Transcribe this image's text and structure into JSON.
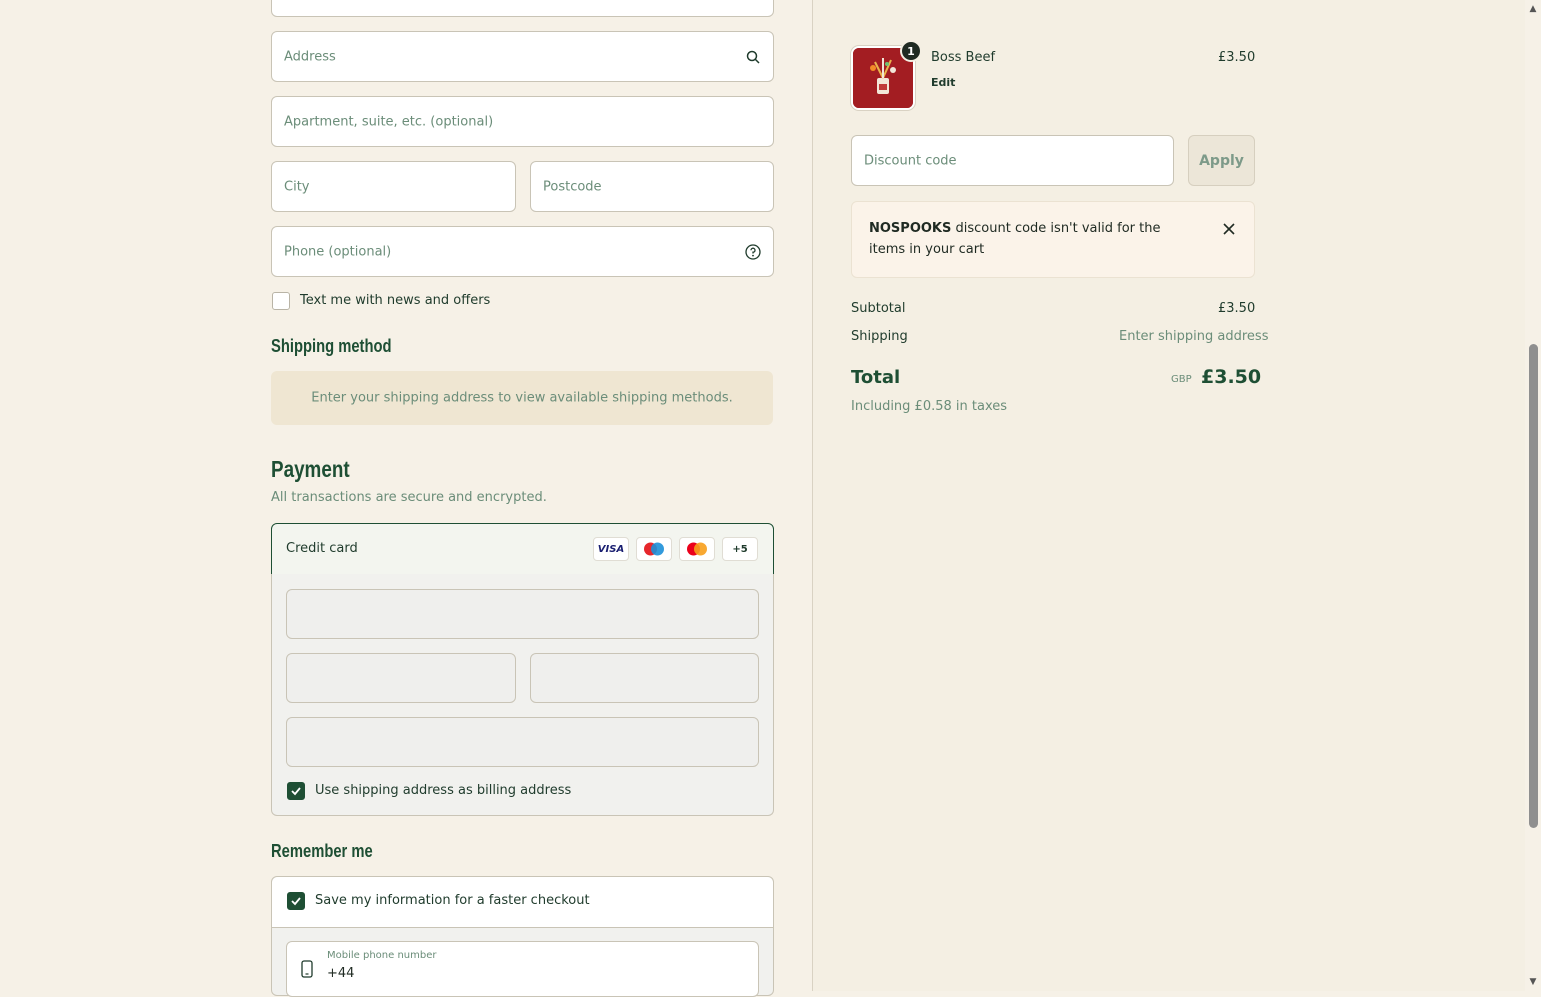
{
  "form": {
    "address_placeholder": "Address",
    "apartment_placeholder": "Apartment, suite, etc. (optional)",
    "city_placeholder": "City",
    "postcode_placeholder": "Postcode",
    "phone_placeholder": "Phone (optional)",
    "text_offers_label": "Text me with news and offers"
  },
  "shipping": {
    "heading": "Shipping method",
    "notice": "Enter your shipping address to view available shipping methods."
  },
  "payment": {
    "heading": "Payment",
    "subtext": "All transactions are secure and encrypted.",
    "method_label": "Credit card",
    "brands": [
      "VISA",
      "maestro",
      "mastercard",
      "+5"
    ],
    "billing_label": "Use shipping address as billing address"
  },
  "remember": {
    "heading": "Remember me",
    "save_label": "Save my information for a faster checkout",
    "mobile_label": "Mobile phone number",
    "mobile_value": "+44"
  },
  "cart": {
    "item_name": "Boss Beef",
    "item_edit": "Edit",
    "item_price": "£3.50",
    "item_qty": "1",
    "discount_placeholder": "Discount code",
    "apply_label": "Apply",
    "notice_code": "NOSPOOKS",
    "notice_text": " discount code isn't valid for the items in your cart",
    "subtotal_label": "Subtotal",
    "subtotal_value": "£3.50",
    "shipping_label": "Shipping",
    "shipping_value": "Enter shipping address",
    "total_label": "Total",
    "total_currency": "GBP",
    "total_value": "£3.50",
    "taxes_text": "Including £0.58 in taxes"
  },
  "colors": {
    "accent": "#1e4f34",
    "muted_text": "#6b8d79",
    "background": "#f6f1e7"
  }
}
